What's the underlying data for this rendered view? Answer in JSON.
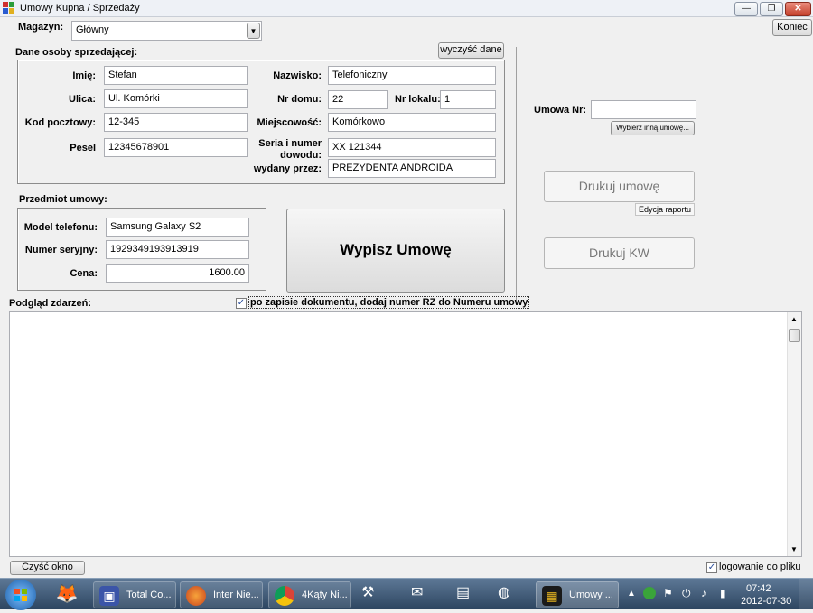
{
  "window": {
    "title": "Umowy Kupna / Sprzedaży",
    "minimize": "—",
    "maximize": "❐",
    "close": "✕"
  },
  "top": {
    "magazyn_label": "Magazyn:",
    "magazyn_value": "Główny",
    "koniec_button": "Koniec"
  },
  "seller": {
    "section_title": "Dane osoby sprzedającej:",
    "clear_button": "wyczyść dane",
    "imie_label": "Imię:",
    "imie_value": "Stefan",
    "nazwisko_label": "Nazwisko:",
    "nazwisko_value": "Telefoniczny",
    "ulica_label": "Ulica:",
    "ulica_value": "Ul. Komórki",
    "nr_domu_label": "Nr domu:",
    "nr_domu_value": "22",
    "nr_lokalu_label": "Nr lokalu:",
    "nr_lokalu_value": "1",
    "kod_label": "Kod pocztowy:",
    "kod_value": "12-345",
    "miejscowosc_label": "Miejscowość:",
    "miejscowosc_value": "Komórkowo",
    "pesel_label": "Pesel",
    "pesel_value": "12345678901",
    "seria_label_1": "Seria i numer",
    "seria_label_2": "dowodu:",
    "seria_value": "XX 121344",
    "wydany_label": "wydany przez:",
    "wydany_value": "PREZYDENTA ANDROIDA"
  },
  "item": {
    "section_title": "Przedmiot umowy:",
    "model_label": "Model telefonu:",
    "model_value": "Samsung Galaxy S2",
    "serial_label": "Numer seryjny:",
    "serial_value": "1929349193913919",
    "cena_label": "Cena:",
    "cena_value": "1600.00",
    "wypisz_button": "Wypisz Umowę"
  },
  "right": {
    "umowa_label": "Umowa Nr:",
    "umowa_value": "",
    "wybierz_button": "Wybierz inną umowę...",
    "drukuj_umowe": "Drukuj umowę",
    "edycja_raportu": "Edycja raportu",
    "drukuj_kw": "Drukuj KW"
  },
  "events": {
    "label": "Podgląd zdarzeń:",
    "rz_checkbox_label": "po zapisie dokumentu, dodaj numer RZ do Numeru umowy",
    "rz_checked": "✓",
    "clear_button": "Czyść okno",
    "log_checkbox_label": "logowanie do pliku",
    "log_checked": "✓"
  },
  "taskbar": {
    "items": [
      {
        "label": "Total Co...",
        "icon": "floppy-icon"
      },
      {
        "label": "Inter Nie...",
        "icon": "firefox-icon"
      },
      {
        "label": "4Kąty Ni...",
        "icon": "chrome-icon"
      },
      {
        "label": "Umowy ...",
        "icon": "app-window-icon"
      }
    ],
    "time": "07:42",
    "date": "2012-07-30"
  }
}
